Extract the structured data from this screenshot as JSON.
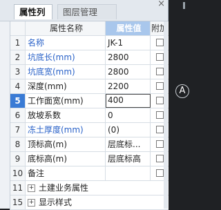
{
  "tabs": [
    {
      "label": "属性列表",
      "active": true
    },
    {
      "label": "图层管理",
      "active": false
    }
  ],
  "close_label": "×",
  "table": {
    "headers": {
      "name": "属性名称",
      "value": "属性值",
      "add": "附加"
    },
    "rows": [
      {
        "num": "1",
        "name": "名称",
        "value": "JK-1",
        "blue": true
      },
      {
        "num": "2",
        "name": "坑底长(mm)",
        "value": "2800",
        "blue": true
      },
      {
        "num": "3",
        "name": "坑底宽(mm)",
        "value": "2800",
        "blue": true
      },
      {
        "num": "4",
        "name": "深度(mm)",
        "value": "2200",
        "blue": false
      },
      {
        "num": "5",
        "name": "工作面宽(mm)",
        "value": "400",
        "blue": false,
        "selected": true
      },
      {
        "num": "6",
        "name": "放坡系数",
        "value": "0",
        "blue": false
      },
      {
        "num": "7",
        "name": "冻土厚度(mm)",
        "value": "(0)",
        "blue": true
      },
      {
        "num": "8",
        "name": "顶标高(m)",
        "value": "层底标...",
        "blue": false
      },
      {
        "num": "9",
        "name": "底标高(m)",
        "value": "层底标高",
        "blue": false
      },
      {
        "num": "10",
        "name": "备注",
        "value": "",
        "blue": false
      }
    ],
    "groups": [
      {
        "num": "11",
        "label": "土建业务属性",
        "expander": "+"
      },
      {
        "num": "15",
        "label": "显示样式",
        "expander": "+"
      }
    ]
  },
  "side_badge": "A",
  "colors": {
    "accent": "#3a7bd5",
    "header_value_bg": "#a9c7ec",
    "blue_text": "#2a62c8"
  }
}
